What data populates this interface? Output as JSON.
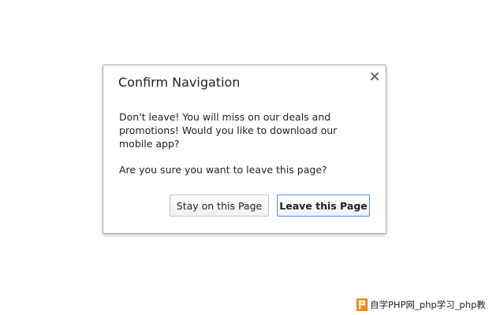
{
  "dialog": {
    "title": "Confirm Navigation",
    "close_icon": "close-icon",
    "message": "Don't leave! You will miss on our deals and promotions! Would you like to download our mobile app?",
    "question": "Are you sure you want to leave this page?",
    "stay_label": "Stay on this Page",
    "leave_label": "Leave this Page",
    "focus_color": "#4d90fe"
  },
  "watermark": {
    "logo_letter": "P",
    "logo_color": "#f08a10",
    "text": "自学PHP网_php学习_php教"
  }
}
